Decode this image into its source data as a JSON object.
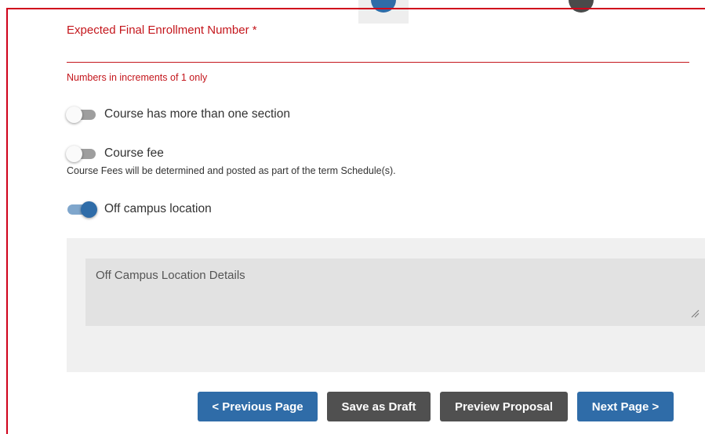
{
  "enrollment": {
    "label": "Expected Final Enrollment Number *",
    "value": "",
    "hint": "Numbers in increments of 1 only"
  },
  "toggles": {
    "multiple_sections": {
      "label": "Course has more than one section",
      "on": false
    },
    "course_fee": {
      "label": "Course fee",
      "on": false,
      "note": "Course Fees will be determined and posted as part of the term Schedule(s)."
    },
    "off_campus": {
      "label": "Off campus location",
      "on": true
    }
  },
  "off_campus_details": {
    "placeholder": "Off Campus Location Details",
    "value": ""
  },
  "buttons": {
    "previous": "< Previous Page",
    "save_draft": "Save as Draft",
    "preview": "Preview Proposal",
    "next": "Next Page >"
  },
  "colors": {
    "error": "#c4161c",
    "primary": "#2f6ca8",
    "secondary": "#505050"
  }
}
